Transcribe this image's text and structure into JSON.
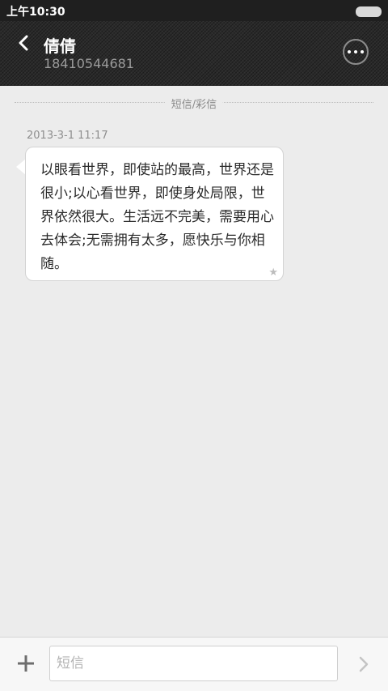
{
  "status_bar": {
    "time": "上午10:30"
  },
  "header": {
    "contact_name": "倩倩",
    "contact_number": "18410544681"
  },
  "conversation": {
    "divider_label": "短信/彩信",
    "messages": [
      {
        "timestamp": "2013-3-1 11:17",
        "text": "以眼看世界，即使站的最高，世界还是很小;以心看世界，即使身处局限，世界依然很大。生活远不完美，需要用心去体会;无需拥有太多，愿快乐与你相随。",
        "starred_icon": "star-icon"
      }
    ]
  },
  "composer": {
    "input_placeholder": "短信",
    "input_value": ""
  },
  "icons": {
    "back": "chevron-left-icon",
    "more": "more-options-icon",
    "add": "plus-icon",
    "send": "chevron-right-icon"
  },
  "colors": {
    "header_bg": "#2a2a2a",
    "page_bg": "#ececec",
    "bubble_bg": "#ffffff",
    "bubble_border": "#d3d3d3"
  }
}
